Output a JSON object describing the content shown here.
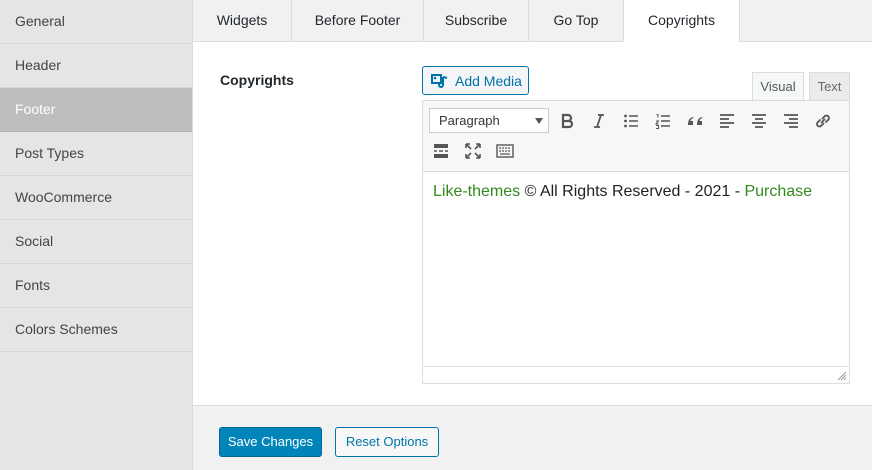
{
  "sidebar": {
    "items": [
      {
        "label": "General"
      },
      {
        "label": "Header"
      },
      {
        "label": "Footer",
        "active": true
      },
      {
        "label": "Post Types"
      },
      {
        "label": "WooCommerce"
      },
      {
        "label": "Social"
      },
      {
        "label": "Fonts"
      },
      {
        "label": "Colors Schemes"
      }
    ]
  },
  "tabs": [
    {
      "label": "Widgets"
    },
    {
      "label": "Before Footer"
    },
    {
      "label": "Subscribe"
    },
    {
      "label": "Go Top"
    },
    {
      "label": "Copyrights",
      "active": true
    }
  ],
  "field": {
    "label": "Copyrights"
  },
  "editor": {
    "add_media_label": "Add Media",
    "mode_visual": "Visual",
    "mode_text": "Text",
    "format_value": "Paragraph",
    "toolbar_icons": [
      "bold-icon",
      "italic-icon",
      "bullet-list-icon",
      "numbered-list-icon",
      "blockquote-icon",
      "align-left-icon",
      "align-center-icon",
      "align-right-icon",
      "link-icon",
      "read-more-icon",
      "fullscreen-icon",
      "keyboard-icon"
    ],
    "content": {
      "link1": "Like-themes",
      "middle": " © All Rights Reserved - 2021 - ",
      "link2": "Purchase"
    },
    "link_color": "#338a1c"
  },
  "actions": {
    "save_label": "Save Changes",
    "reset_label": "Reset Options"
  },
  "colors": {
    "primary": "#0085ba",
    "accent": "#0073aa"
  }
}
